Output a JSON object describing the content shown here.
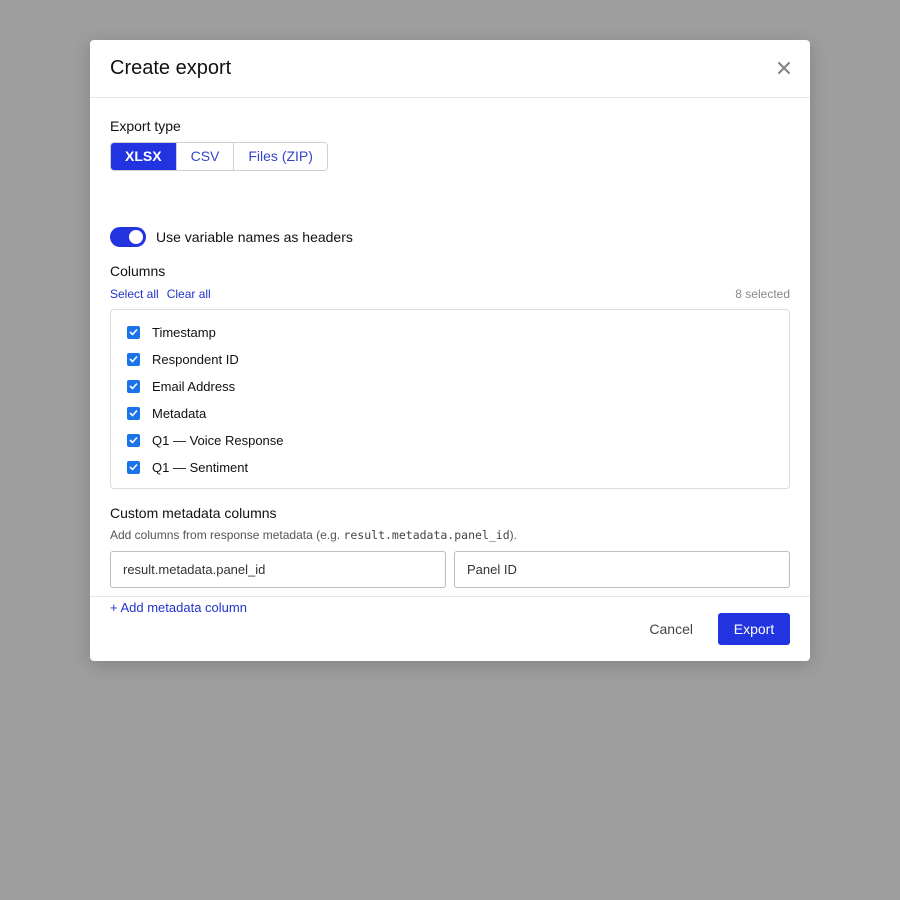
{
  "modal": {
    "title": "Create export",
    "close_icon": "close-icon"
  },
  "export_type": {
    "label": "Export type",
    "options": [
      "XLSX",
      "CSV",
      "Files (ZIP)"
    ],
    "selected": "XLSX"
  },
  "headers_toggle": {
    "label": "Use variable names as headers",
    "on": true
  },
  "columns": {
    "label": "Columns",
    "select_all": "Select all",
    "clear_all": "Clear all",
    "selected_count": "8 selected",
    "items": [
      {
        "label": "Timestamp",
        "checked": true
      },
      {
        "label": "Respondent ID",
        "checked": true
      },
      {
        "label": "Email Address",
        "checked": true
      },
      {
        "label": "Metadata",
        "checked": true
      },
      {
        "label": "Q1 — Voice Response",
        "checked": true
      },
      {
        "label": "Q1 — Sentiment",
        "checked": true
      }
    ]
  },
  "custom_metadata": {
    "label": "Custom metadata columns",
    "hint_prefix": "Add columns from response metadata (e.g. ",
    "hint_code": "result.metadata.panel_id",
    "hint_suffix": ").",
    "path_value": "result.metadata.panel_id",
    "name_value": "Panel ID",
    "add_label": "+ Add metadata column"
  },
  "footer": {
    "cancel_label": "Cancel",
    "export_label": "Export"
  },
  "colors": {
    "accent": "#2233e0",
    "checkbox": "#1a73e8",
    "overlay": "#9e9e9e"
  }
}
